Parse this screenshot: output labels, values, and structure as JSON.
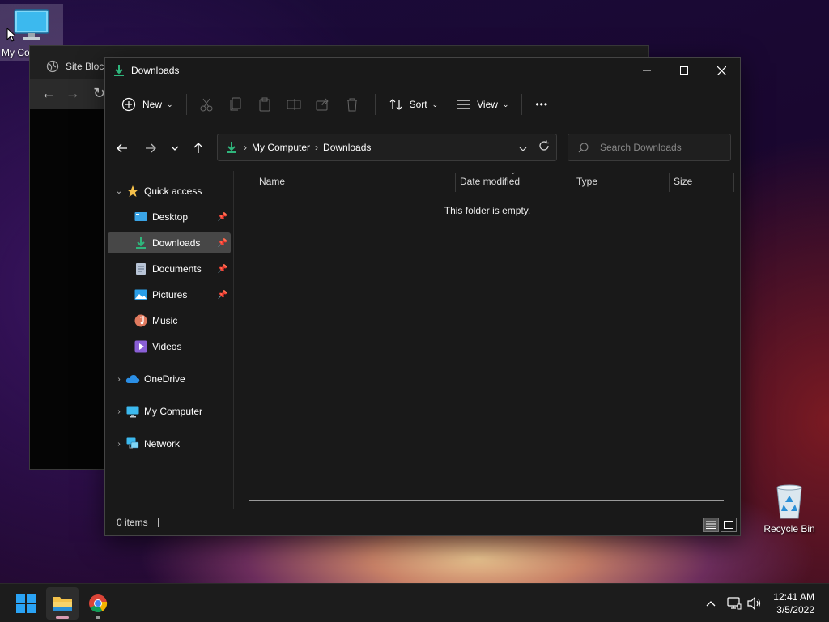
{
  "desktop": {
    "my_computer_label": "My Co",
    "recycle_bin_label": "Recycle Bin"
  },
  "bg_window": {
    "title": "Site Block"
  },
  "explorer": {
    "title": "Downloads",
    "toolbar": {
      "new_label": "New",
      "sort_label": "Sort",
      "view_label": "View",
      "more_label": "•••"
    },
    "address": {
      "crumbs": [
        "My Computer",
        "Downloads"
      ],
      "search_placeholder": "Search Downloads"
    },
    "nav": {
      "quick_access": "Quick access",
      "items": [
        {
          "label": "Desktop",
          "icon": "desktop-icon",
          "pinned": true
        },
        {
          "label": "Downloads",
          "icon": "download-icon",
          "pinned": true,
          "selected": true
        },
        {
          "label": "Documents",
          "icon": "document-icon",
          "pinned": true
        },
        {
          "label": "Pictures",
          "icon": "pictures-icon",
          "pinned": true
        },
        {
          "label": "Music",
          "icon": "music-icon",
          "pinned": false
        },
        {
          "label": "Videos",
          "icon": "videos-icon",
          "pinned": false
        }
      ],
      "onedrive": "OneDrive",
      "my_computer": "My Computer",
      "network": "Network"
    },
    "columns": [
      "Name",
      "Date modified",
      "Type",
      "Size"
    ],
    "empty_message": "This folder is empty.",
    "status": {
      "items_count": "0 items"
    }
  },
  "taskbar": {
    "time": "12:41 AM",
    "date": "3/5/2022"
  },
  "colors": {
    "accent_green": "#2fb67c",
    "selection": "#474747",
    "windows_blue": "#2aa3f5"
  }
}
